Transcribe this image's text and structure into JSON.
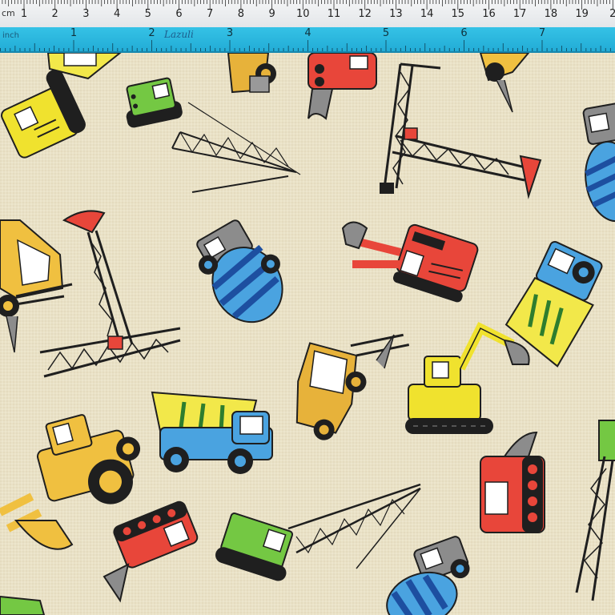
{
  "rulers": {
    "cm_unit": "cm",
    "cm_labels": [
      "1",
      "2",
      "3",
      "4",
      "5",
      "6",
      "7",
      "8",
      "9",
      "10",
      "11",
      "12",
      "13",
      "14",
      "15",
      "16",
      "17",
      "18",
      "19",
      "2"
    ],
    "inch_unit": "inch",
    "inch_labels": [
      "1",
      "2",
      "3",
      "4",
      "5",
      "6",
      "7"
    ],
    "brand_text": "Lazuli"
  },
  "fabric": {
    "background_color": "#e9e1c6",
    "motifs": [
      {
        "name": "crane-icon",
        "color": "#74c843"
      },
      {
        "name": "tower-crane-icon",
        "color": "#e8463a"
      },
      {
        "name": "cement-mixer-icon",
        "color": "#4aa3e0"
      },
      {
        "name": "excavator-icon",
        "color": "#f0e22e"
      },
      {
        "name": "dump-truck-icon",
        "color": "#f2e84a"
      },
      {
        "name": "forklift-icon",
        "color": "#e7b23a"
      },
      {
        "name": "bulldozer-icon",
        "color": "#e8463a"
      },
      {
        "name": "backhoe-loader-icon",
        "color": "#f0c040"
      }
    ]
  }
}
